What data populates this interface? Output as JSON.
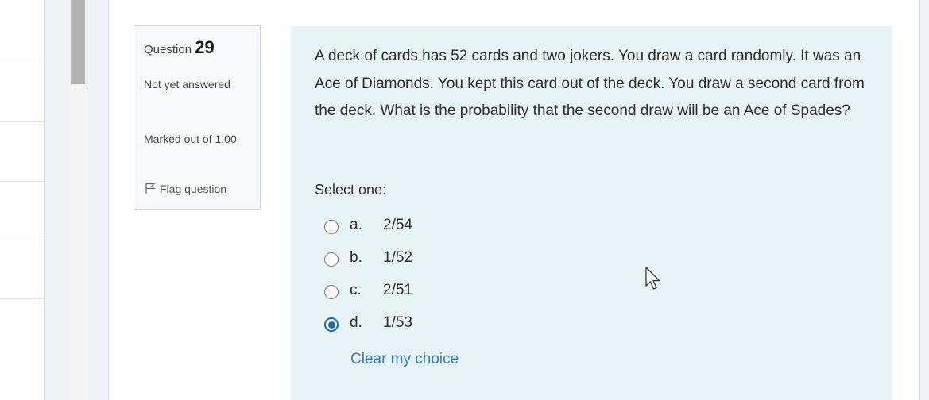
{
  "question_info": {
    "label": "Question",
    "number": "29",
    "state": "Not yet answered",
    "grade": "Marked out of 1.00",
    "flag_label": "Flag question",
    "flag_icon": "flag-icon"
  },
  "question": {
    "text": "A deck of cards has 52 cards and two jokers. You draw a card randomly. It was an Ace of Diamonds. You kept this card out of the deck. You draw a second card from the deck. What is the probability that the second draw will be an Ace of Spades?",
    "prompt": "Select one:",
    "answers": [
      {
        "letter": "a.",
        "text": "2/54",
        "selected": false
      },
      {
        "letter": "b.",
        "text": "1/52",
        "selected": false
      },
      {
        "letter": "c.",
        "text": "2/51",
        "selected": false
      },
      {
        "letter": "d.",
        "text": "1/53",
        "selected": true
      }
    ],
    "clear_label": "Clear my choice"
  },
  "colors": {
    "content_bg": "#e7f3f5",
    "accent": "#0f6cbf",
    "link": "#2f7fbf"
  }
}
